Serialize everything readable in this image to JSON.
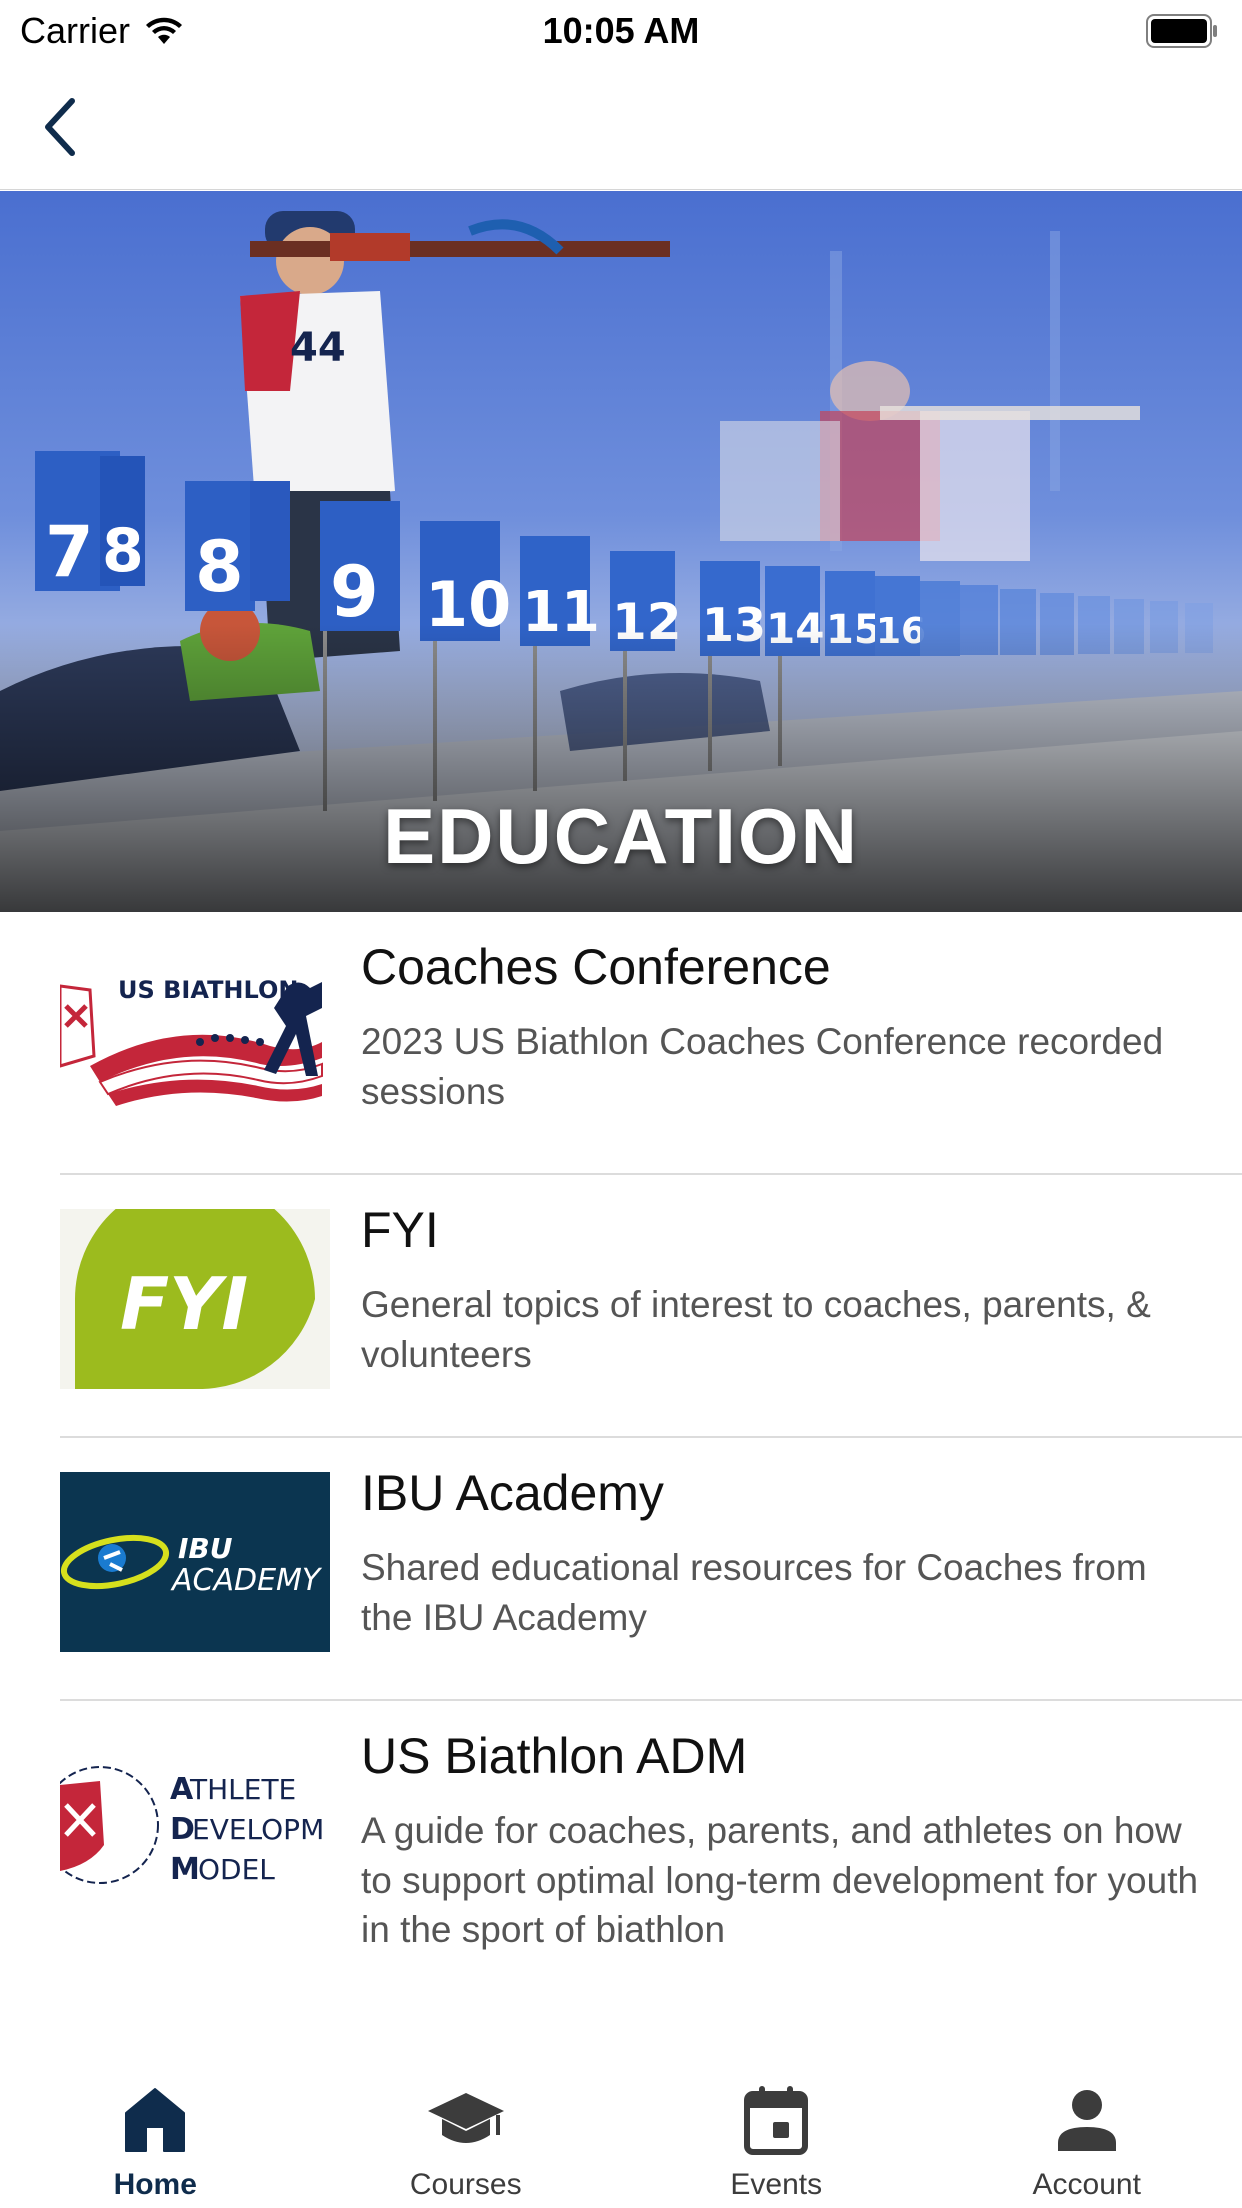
{
  "status_bar": {
    "carrier": "Carrier",
    "time": "10:05 AM"
  },
  "nav": {
    "back_icon": "chevron-left-icon"
  },
  "hero": {
    "title": "EDUCATION",
    "image": "biathlon-shooting-range-photo"
  },
  "items": [
    {
      "title": "Coaches Conference",
      "description": "2023 US Biathlon Coaches Conference recorded sessions",
      "thumb": "us-biathlon-logo",
      "thumb_text": "US BIATHLON"
    },
    {
      "title": "FYI",
      "description": "General topics of interest to coaches, parents, & volunteers",
      "thumb": "fyi-logo",
      "thumb_text": "FYI"
    },
    {
      "title": "IBU Academy",
      "description": "Shared educational resources for Coaches from the IBU Academy",
      "thumb": "ibu-academy-logo",
      "thumb_text": "IBU ACADEMY"
    },
    {
      "title": "US Biathlon ADM",
      "description": "A guide for coaches, parents, and athletes on how to support optimal long-term development for youth in the sport of biathlon",
      "thumb": "athlete-development-model-logo",
      "thumb_text": "ATHLETE DEVELOPMENT MODEL"
    }
  ],
  "tabs": [
    {
      "label": "Home",
      "icon": "home-icon",
      "active": true
    },
    {
      "label": "Courses",
      "icon": "graduation-cap-icon",
      "active": false
    },
    {
      "label": "Events",
      "icon": "calendar-icon",
      "active": false
    },
    {
      "label": "Account",
      "icon": "person-icon",
      "active": false
    }
  ],
  "colors": {
    "brand_navy": "#0f2c4c",
    "tab_inactive": "#3c3c3c",
    "fyi_green": "#9cbb1e",
    "ibu_navy": "#0b3550"
  }
}
